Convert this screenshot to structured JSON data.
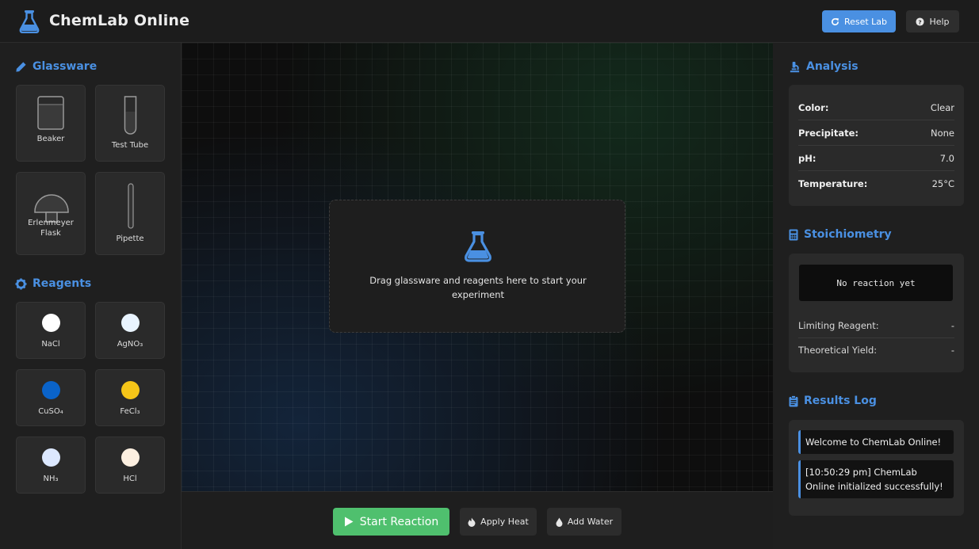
{
  "header": {
    "app_title": "ChemLab Online",
    "logo_icon": "flask-icon",
    "reset_label": "Reset Lab",
    "help_label": "Help"
  },
  "sidebar": {
    "glassware_title": "Glassware",
    "glassware": [
      {
        "label": "Beaker",
        "icon": "beaker-icon"
      },
      {
        "label": "Test Tube",
        "icon": "test-tube-icon"
      },
      {
        "label": "Erlenmeyer Flask",
        "icon": "erlenmeyer-flask-icon"
      },
      {
        "label": "Pipette",
        "icon": "pipette-icon"
      }
    ],
    "reagents_title": "Reagents",
    "reagents": [
      {
        "label": "NaCl",
        "color": "#ffffff"
      },
      {
        "label": "AgNO₃",
        "color": "#e9f4ff"
      },
      {
        "label": "CuSO₄",
        "color": "#0a63c9"
      },
      {
        "label": "FeCl₃",
        "color": "#f5c518"
      },
      {
        "label": "NH₃",
        "color": "#dce8ff"
      },
      {
        "label": "HCl",
        "color": "#fcefe0"
      }
    ]
  },
  "workspace": {
    "drop_text": "Drag glassware and reagents here to start your experiment",
    "drop_icon": "flask-icon"
  },
  "controls": {
    "start_label": "Start Reaction",
    "heat_label": "Apply Heat",
    "water_label": "Add Water"
  },
  "analysis": {
    "title": "Analysis",
    "rows": [
      {
        "key": "Color:",
        "value": "Clear"
      },
      {
        "key": "Precipitate:",
        "value": "None"
      },
      {
        "key": "pH:",
        "value": "7.0"
      },
      {
        "key": "Temperature:",
        "value": "25°C"
      }
    ]
  },
  "stoichiometry": {
    "title": "Stoichiometry",
    "equation": "No reaction yet",
    "rows": [
      {
        "key": "Limiting Reagent:",
        "value": "-"
      },
      {
        "key": "Theoretical Yield:",
        "value": "-"
      }
    ]
  },
  "results": {
    "title": "Results Log",
    "entries": [
      "Welcome to ChemLab Online!",
      "[10:50:29 pm] ChemLab Online initialized successfully!"
    ]
  },
  "colors": {
    "accent": "#4a90e2",
    "start": "#4fc06e"
  }
}
